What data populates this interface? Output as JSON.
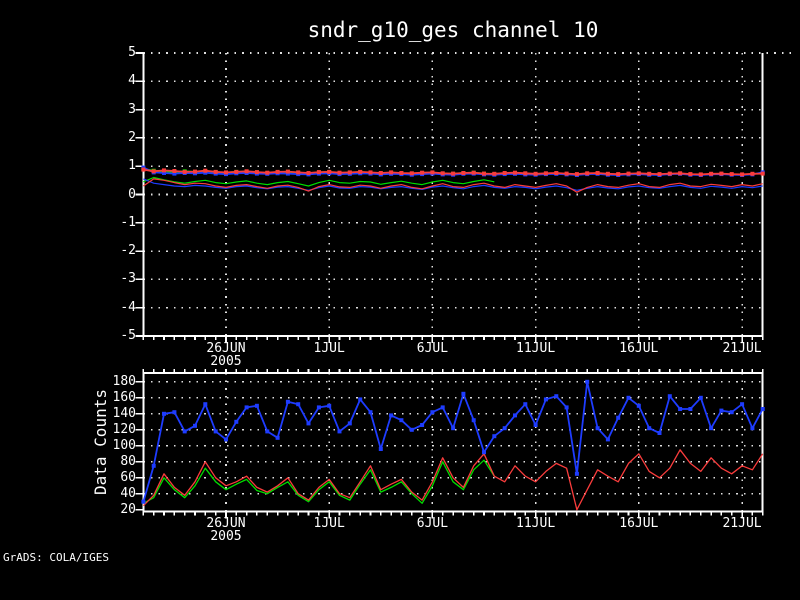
{
  "title": "sndr_g10_ges channel 10",
  "watermark": "GrADS: COLA/IGES",
  "bottom_panel": {
    "ylabel": "Data Counts"
  },
  "colors": {
    "background": "#000000",
    "axis": "#ffffff",
    "grid": "#e0e0e0",
    "text": "#ffffff",
    "red": "#fa3c3c",
    "green": "#00dc00",
    "blue": "#1e3cff"
  },
  "chart_data": [
    {
      "type": "line",
      "panel": "top",
      "title": "sndr_g10_ges channel 10",
      "xlabel": "",
      "ylabel": "",
      "ylim": [
        -5,
        5
      ],
      "ytick_labels": [
        "5",
        "4",
        "3",
        "2",
        "1",
        "0",
        "-1",
        "-2",
        "-3",
        "-4",
        "-5"
      ],
      "x_tick_labels": [
        {
          "label": "26JUN",
          "day": 4
        },
        {
          "label": "1JUL",
          "day": 9
        },
        {
          "label": "6JUL",
          "day": 14
        },
        {
          "label": "11JUL",
          "day": 19
        },
        {
          "label": "16JUL",
          "day": 24
        },
        {
          "label": "21JUL",
          "day": 29
        }
      ],
      "year_label": "2005",
      "x_step_days": 0.5,
      "x_range_days": [
        0,
        30
      ],
      "grid": "dotted",
      "legend": "none",
      "series": [
        {
          "name": "green-lower",
          "color_key": "green",
          "marker": false,
          "width": 1.2,
          "values": [
            0.45,
            0.6,
            0.52,
            0.45,
            0.4,
            0.46,
            0.5,
            0.42,
            0.38,
            0.44,
            0.48,
            0.4,
            0.35,
            0.42,
            0.46,
            0.38,
            0.3,
            0.42,
            0.5,
            0.42,
            0.4,
            0.46,
            0.44,
            0.36,
            0.42,
            0.47,
            0.4,
            0.35,
            0.44,
            0.5,
            0.42,
            0.38,
            0.46,
            0.52,
            0.45
          ]
        },
        {
          "name": "blue-lower",
          "color_key": "blue",
          "marker": false,
          "width": 1.2,
          "values": [
            0.55,
            0.4,
            0.35,
            0.3,
            0.28,
            0.32,
            0.3,
            0.25,
            0.22,
            0.28,
            0.3,
            0.24,
            0.2,
            0.26,
            0.28,
            0.22,
            0.15,
            0.24,
            0.3,
            0.23,
            0.22,
            0.28,
            0.26,
            0.2,
            0.25,
            0.28,
            0.22,
            0.18,
            0.26,
            0.3,
            0.24,
            0.2,
            0.28,
            0.32,
            0.25,
            0.22,
            0.28,
            0.25,
            0.2,
            0.26,
            0.3,
            0.24,
            0.15,
            0.22,
            0.28,
            0.23,
            0.2,
            0.27,
            0.3,
            0.24,
            0.22,
            0.28,
            0.32,
            0.25,
            0.22,
            0.29,
            0.26,
            0.22,
            0.28,
            0.24,
            0.3
          ]
        },
        {
          "name": "red-lower",
          "color_key": "red",
          "marker": false,
          "width": 1.2,
          "values": [
            0.3,
            0.55,
            0.5,
            0.42,
            0.35,
            0.4,
            0.38,
            0.3,
            0.25,
            0.32,
            0.35,
            0.28,
            0.22,
            0.3,
            0.33,
            0.25,
            0.12,
            0.28,
            0.35,
            0.27,
            0.25,
            0.33,
            0.3,
            0.22,
            0.3,
            0.35,
            0.25,
            0.2,
            0.3,
            0.38,
            0.28,
            0.25,
            0.35,
            0.4,
            0.3,
            0.25,
            0.35,
            0.3,
            0.25,
            0.32,
            0.38,
            0.3,
            0.08,
            0.25,
            0.35,
            0.28,
            0.25,
            0.33,
            0.38,
            0.28,
            0.25,
            0.35,
            0.4,
            0.3,
            0.28,
            0.36,
            0.32,
            0.28,
            0.35,
            0.3,
            0.38
          ]
        },
        {
          "name": "green-mean",
          "color_key": "green",
          "marker": true,
          "width": 1.8,
          "values": [
            0.9,
            0.84,
            0.82,
            0.8,
            0.82,
            0.8,
            0.83,
            0.79,
            0.77,
            0.8,
            0.81,
            0.78,
            0.76,
            0.79,
            0.8,
            0.77,
            0.75,
            0.78,
            0.79,
            0.76,
            0.77,
            0.79,
            0.77,
            0.74,
            0.77,
            0.75,
            0.74,
            0.76,
            0.77,
            0.74,
            0.73,
            0.76,
            0.77,
            0.74,
            0.72
          ]
        },
        {
          "name": "blue-mean",
          "color_key": "blue",
          "marker": true,
          "width": 1.8,
          "values": [
            0.95,
            0.78,
            0.76,
            0.74,
            0.76,
            0.75,
            0.77,
            0.74,
            0.72,
            0.75,
            0.76,
            0.74,
            0.73,
            0.75,
            0.74,
            0.72,
            0.71,
            0.74,
            0.75,
            0.72,
            0.73,
            0.75,
            0.74,
            0.71,
            0.73,
            0.72,
            0.7,
            0.72,
            0.74,
            0.71,
            0.7,
            0.73,
            0.74,
            0.71,
            0.7,
            0.72,
            0.73,
            0.71,
            0.7,
            0.72,
            0.73,
            0.71,
            0.69,
            0.72,
            0.73,
            0.7,
            0.69,
            0.71,
            0.72,
            0.7,
            0.69,
            0.72,
            0.73,
            0.7,
            0.69,
            0.71,
            0.72,
            0.7,
            0.69,
            0.71,
            0.78
          ]
        },
        {
          "name": "red-mean",
          "color_key": "red",
          "marker": true,
          "width": 1.8,
          "values": [
            0.88,
            0.82,
            0.85,
            0.83,
            0.8,
            0.81,
            0.84,
            0.8,
            0.78,
            0.8,
            0.82,
            0.79,
            0.77,
            0.8,
            0.81,
            0.78,
            0.76,
            0.79,
            0.8,
            0.77,
            0.78,
            0.8,
            0.78,
            0.76,
            0.78,
            0.76,
            0.75,
            0.77,
            0.78,
            0.75,
            0.74,
            0.76,
            0.77,
            0.74,
            0.73,
            0.76,
            0.77,
            0.75,
            0.73,
            0.75,
            0.76,
            0.74,
            0.72,
            0.75,
            0.76,
            0.73,
            0.72,
            0.74,
            0.75,
            0.73,
            0.72,
            0.74,
            0.75,
            0.72,
            0.71,
            0.73,
            0.74,
            0.72,
            0.71,
            0.73,
            0.74
          ]
        }
      ]
    },
    {
      "type": "line",
      "panel": "bottom",
      "title": "",
      "xlabel": "",
      "ylabel": "Data Counts",
      "ylim": [
        20,
        180
      ],
      "ytick_labels": [
        "180",
        "160",
        "140",
        "120",
        "100",
        "80",
        "60",
        "40",
        "20"
      ],
      "x_tick_labels": [
        {
          "label": "26JUN",
          "day": 4
        },
        {
          "label": "1JUL",
          "day": 9
        },
        {
          "label": "6JUL",
          "day": 14
        },
        {
          "label": "11JUL",
          "day": 19
        },
        {
          "label": "16JUL",
          "day": 24
        },
        {
          "label": "21JUL",
          "day": 29
        }
      ],
      "year_label": "2005",
      "x_step_days": 0.5,
      "x_range_days": [
        0,
        30
      ],
      "grid": "dotted",
      "legend": "none",
      "series": [
        {
          "name": "green-counts",
          "color_key": "green",
          "marker": false,
          "width": 1.3,
          "values": [
            28,
            35,
            60,
            45,
            35,
            50,
            72,
            55,
            45,
            52,
            58,
            44,
            40,
            48,
            55,
            38,
            30,
            45,
            55,
            38,
            32,
            52,
            70,
            42,
            48,
            55,
            40,
            28,
            50,
            80,
            55,
            45,
            70,
            82,
            62
          ]
        },
        {
          "name": "red-counts",
          "color_key": "red",
          "marker": false,
          "width": 1.3,
          "values": [
            25,
            38,
            65,
            48,
            38,
            55,
            80,
            60,
            50,
            55,
            62,
            48,
            42,
            50,
            60,
            40,
            32,
            48,
            58,
            40,
            35,
            55,
            75,
            45,
            52,
            58,
            42,
            32,
            55,
            85,
            60,
            48,
            75,
            90,
            62,
            55,
            75,
            62,
            55,
            68,
            78,
            72,
            20,
            45,
            70,
            62,
            55,
            78,
            90,
            68,
            60,
            72,
            95,
            78,
            68,
            85,
            72,
            65,
            75,
            70,
            90
          ]
        },
        {
          "name": "blue-counts",
          "color_key": "blue",
          "marker": true,
          "width": 1.8,
          "values": [
            30,
            75,
            140,
            142,
            118,
            125,
            152,
            118,
            108,
            130,
            148,
            150,
            118,
            110,
            155,
            152,
            128,
            148,
            150,
            118,
            128,
            158,
            142,
            96,
            138,
            132,
            120,
            126,
            142,
            148,
            122,
            165,
            132,
            92,
            112,
            122,
            138,
            152,
            126,
            158,
            162,
            148,
            65,
            180,
            122,
            108,
            135,
            160,
            150,
            122,
            116,
            162,
            146,
            146,
            160,
            122,
            144,
            142,
            152,
            122,
            146
          ]
        }
      ]
    }
  ]
}
